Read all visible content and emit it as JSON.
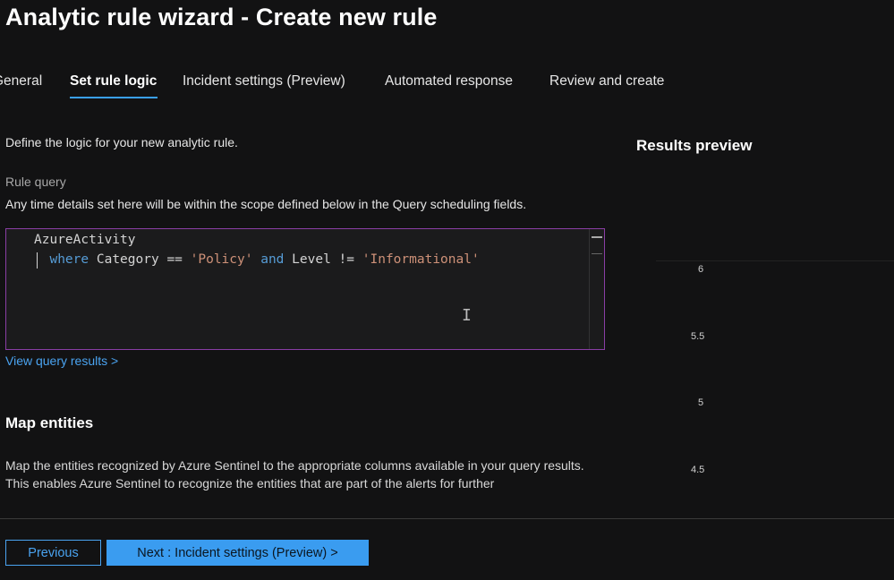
{
  "header": {
    "title": "Analytic rule wizard - Create new rule"
  },
  "tabs": [
    {
      "label": "General"
    },
    {
      "label": "Set rule logic",
      "active": true
    },
    {
      "label": "Incident settings (Preview)"
    },
    {
      "label": "Automated response"
    },
    {
      "label": "Review and create"
    }
  ],
  "main": {
    "intro": "Define the logic for your new analytic rule.",
    "rule_query_label": "Rule query",
    "rule_query_desc": "Any time details set here will be within the scope defined below in the Query scheduling fields.",
    "query": {
      "line1": "AzureActivity",
      "line2": {
        "kw_where": "where",
        "field1": "Category",
        "op1": "==",
        "val1": "'Policy'",
        "kw_and": "and",
        "field2": "Level",
        "op2": "!=",
        "val2": "'Informational'"
      }
    },
    "view_query_results": "View query results >",
    "map_entities_title": "Map entities",
    "map_entities_p1": "Map the entities recognized by Azure Sentinel to the appropriate columns available in your query results.",
    "map_entities_p2": "This enables Azure Sentinel to recognize the entities that are part of the alerts for further"
  },
  "results_preview": {
    "title": "Results preview",
    "y_ticks": [
      "6",
      "5.5",
      "5",
      "4.5"
    ]
  },
  "footer": {
    "previous_label": "Previous",
    "next_label": "Next : Incident settings (Preview) >"
  },
  "colors": {
    "accent": "#3a9cf0",
    "editor_border": "#8a3ea5",
    "keyword": "#569cd6",
    "string": "#ce9178"
  },
  "icons": {
    "text_cursor": "i-beam-cursor-icon"
  }
}
